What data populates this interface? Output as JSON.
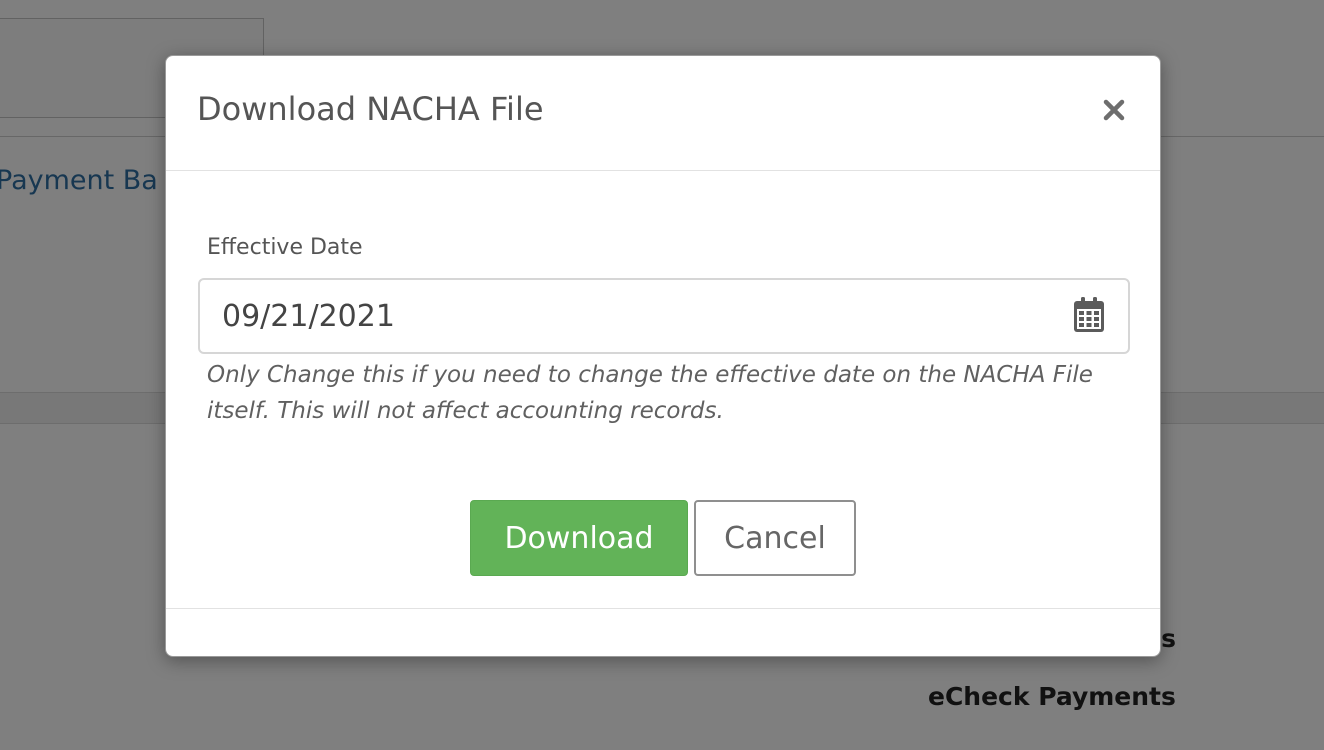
{
  "background": {
    "heading_fragment": "",
    "link_fragment": "Payment Ba",
    "heading_s_fragment": "s",
    "echeck_heading": "eCheck Payments"
  },
  "modal": {
    "title": "Download NACHA File",
    "close_icon": "close-x-icon",
    "field_label": "Effective Date",
    "date_value": "09/21/2021",
    "calendar_icon": "calendar-icon",
    "help_text": "Only Change this if you need to change the effective date on the NACHA File itself. This will not affect accounting records.",
    "download_label": "Download",
    "cancel_label": "Cancel"
  },
  "colors": {
    "overlay": "#000000",
    "download_button": "#62b358",
    "title_text": "#555555",
    "link": "#2e6fa3"
  }
}
